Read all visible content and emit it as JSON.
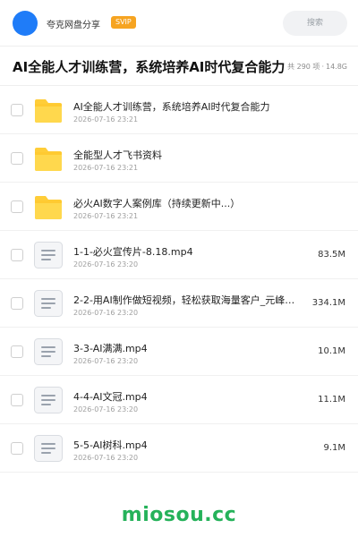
{
  "header": {
    "avatar_icon": "user-avatar-icon",
    "app_name": "夸克网盘分享",
    "badge": "SVIP",
    "search_placeholder": "搜索",
    "accent_color": "#1f7cf8",
    "badge_color": "#f6a421"
  },
  "folder": {
    "title": "AI全能人才训练营，系统培养AI时代复合能力",
    "count_text": "共 290 项",
    "separator": "·",
    "total_size": "14.8G"
  },
  "files": [
    {
      "type": "folder",
      "icon": "folder-icon",
      "name": "AI全能人才训练营，系统培养AI时代复合能力",
      "date": "2026-07-16 23:21",
      "size": ""
    },
    {
      "type": "folder",
      "icon": "folder-icon",
      "name": "全能型人才飞书资料",
      "date": "2026-07-16 23:21",
      "size": ""
    },
    {
      "type": "folder",
      "icon": "folder-icon",
      "name": "必火AI数字人案例库（持续更新中...）",
      "date": "2026-07-16 23:21",
      "size": ""
    },
    {
      "type": "video",
      "icon": "video-file-icon",
      "name": "1-1-必火宣传片-8.18.mp4",
      "date": "2026-07-16 23:20",
      "size": "83.5M"
    },
    {
      "type": "video",
      "icon": "video-file-icon",
      "name": "2-2-用AI制作做短视频，轻松获取海量客户_元峰.mp4",
      "date": "2026-07-16 23:20",
      "size": "334.1M"
    },
    {
      "type": "video",
      "icon": "video-file-icon",
      "name": "3-3-AI满满.mp4",
      "date": "2026-07-16 23:20",
      "size": "10.1M"
    },
    {
      "type": "video",
      "icon": "video-file-icon",
      "name": "4-4-AI文冠.mp4",
      "date": "2026-07-16 23:20",
      "size": "11.1M"
    },
    {
      "type": "video",
      "icon": "video-file-icon",
      "name": "5-5-AI树科.mp4",
      "date": "2026-07-16 23:20",
      "size": "9.1M"
    }
  ],
  "watermark": {
    "text": "miosou.cc",
    "color": "#25b25a"
  }
}
